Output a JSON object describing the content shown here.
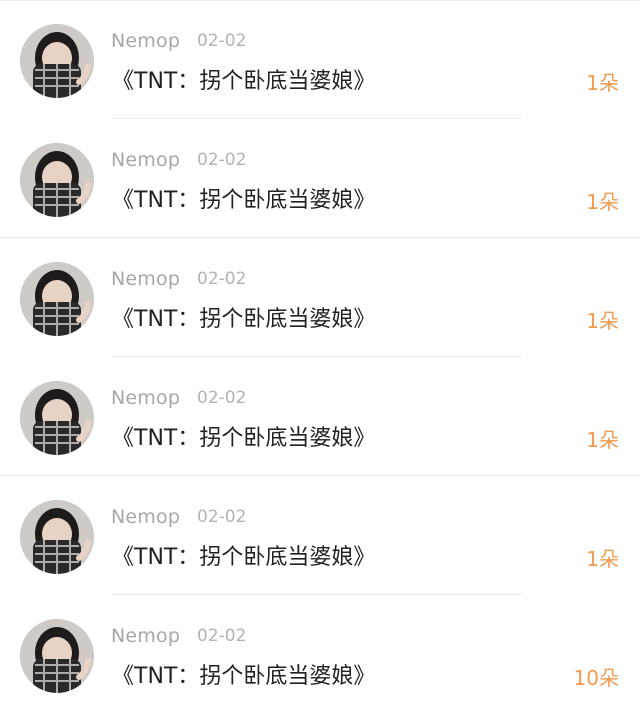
{
  "gifts": [
    {
      "name": "Nemop",
      "date": "02-02",
      "title": "《TNT：拐个卧底当婆娘》",
      "count": "1朵",
      "avatar": "user-avatar"
    },
    {
      "name": "Nemop",
      "date": "02-02",
      "title": "《TNT：拐个卧底当婆娘》",
      "count": "1朵",
      "avatar": "user-avatar"
    },
    {
      "name": "Nemop",
      "date": "02-02",
      "title": "《TNT：拐个卧底当婆娘》",
      "count": "1朵",
      "avatar": "user-avatar"
    },
    {
      "name": "Nemop",
      "date": "02-02",
      "title": "《TNT：拐个卧底当婆娘》",
      "count": "1朵",
      "avatar": "user-avatar"
    },
    {
      "name": "Nemop",
      "date": "02-02",
      "title": "《TNT：拐个卧底当婆娘》",
      "count": "1朵",
      "avatar": "user-avatar"
    },
    {
      "name": "Nemop",
      "date": "02-02",
      "title": "《TNT：拐个卧底当婆娘》",
      "count": "10朵",
      "avatar": "user-avatar"
    }
  ],
  "colors": {
    "name": "#a7a7a7",
    "date": "#b3b3b3",
    "title": "#222222",
    "count": "#f29a4f",
    "divider": "#eeeeee"
  }
}
